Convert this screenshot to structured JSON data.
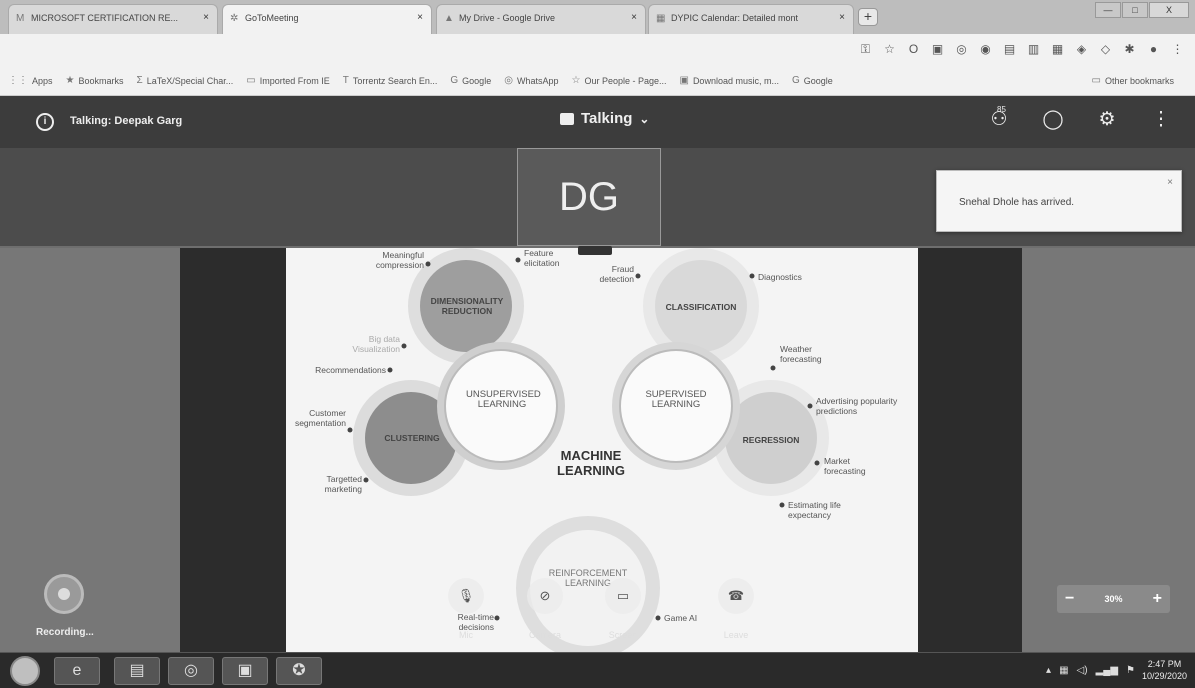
{
  "browser": {
    "tabs": [
      {
        "label": "MICROSOFT CERTIFICATION RE...",
        "icon": "gmail-icon",
        "icon_glyph": "M"
      },
      {
        "label": "GoToMeeting",
        "icon": "gotomeeting-icon",
        "icon_glyph": "✲"
      },
      {
        "label": "My Drive - Google Drive",
        "icon": "drive-icon",
        "icon_glyph": "▲"
      },
      {
        "label": "DYPIC Calendar: Detailed mont",
        "icon": "calendar-icon",
        "icon_glyph": "▦"
      }
    ],
    "tab_close_glyph": "×",
    "new_tab_glyph": "+",
    "window_controls": {
      "minimize": "—",
      "maximize": "□",
      "close": "X"
    },
    "bookmarks": [
      {
        "label": "Apps",
        "icon": "apps-icon",
        "glyph": "⋮⋮"
      },
      {
        "label": "Bookmarks",
        "icon": "star-icon",
        "glyph": "★"
      },
      {
        "label": "LaTeX/Special Char...",
        "icon": "latex-icon",
        "glyph": "Σ"
      },
      {
        "label": "Imported From IE",
        "icon": "folder-icon",
        "glyph": "▭"
      },
      {
        "label": "Torrentz Search En...",
        "icon": "torrentz-icon",
        "glyph": "T"
      },
      {
        "label": "Google",
        "icon": "google-icon",
        "glyph": "G"
      },
      {
        "label": "WhatsApp",
        "icon": "whatsapp-icon",
        "glyph": "◎"
      },
      {
        "label": "Our People - Page...",
        "icon": "people-icon",
        "glyph": "☆"
      },
      {
        "label": "Download music, m...",
        "icon": "download-icon",
        "glyph": "▣"
      },
      {
        "label": "Google",
        "icon": "google-icon",
        "glyph": "G"
      }
    ],
    "other_bookmarks": "Other bookmarks"
  },
  "meeting": {
    "talking": "Talking: Deepak Garg",
    "view_mode": "Talking",
    "attendee_badge": "85",
    "avatar_initials": "DG",
    "toast": "Snehal Dhole has arrived.",
    "toast_close": "×",
    "header_icons": {
      "attendees": "attendees-icon",
      "chat": "chat-icon",
      "settings": "gear-icon",
      "more": "more-vertical-icon"
    }
  },
  "slide": {
    "center_title": "MACHINE LEARNING",
    "sections": {
      "dimensionality_reduction": "DIMENSIONALITY REDUCTION",
      "classification": "CLASSIFICATION",
      "unsupervised": "UNSUPERVISED LEARNING",
      "supervised": "SUPERVISED LEARNING",
      "clustering": "CLUSTERING",
      "regression": "REGRESSION",
      "reinforcement": "REINFORCEMENT LEARNING"
    },
    "leaves": {
      "meaningful_compression": "Meaningful compression",
      "feature_elicitation": "Feature elicitation",
      "fraud_detection": "Fraud detection",
      "diagnostics": "Diagnostics",
      "big_data_visualization": "Big data Visualization",
      "weather_forecasting": "Weather forecasting",
      "recommendations": "Recommendations",
      "advertising": "Advertising popularity predictions",
      "customer_segmentation": "Customer segmentation",
      "market_forecasting": "Market forecasting",
      "targetted_marketing": "Targetted marketing",
      "life_expectancy": "Estimating life expectancy",
      "realtime_decisions": "Real-time decisions",
      "game_ai": "Game AI"
    }
  },
  "controls": {
    "recording": "Recording...",
    "mic": "Mic",
    "camera": "Camera",
    "screen": "Screen",
    "leave": "Leave",
    "zoom_value": "30%",
    "zoom_minus": "−",
    "zoom_plus": "+"
  },
  "taskbar": {
    "time": "2:47 PM",
    "date": "10/29/2020"
  }
}
